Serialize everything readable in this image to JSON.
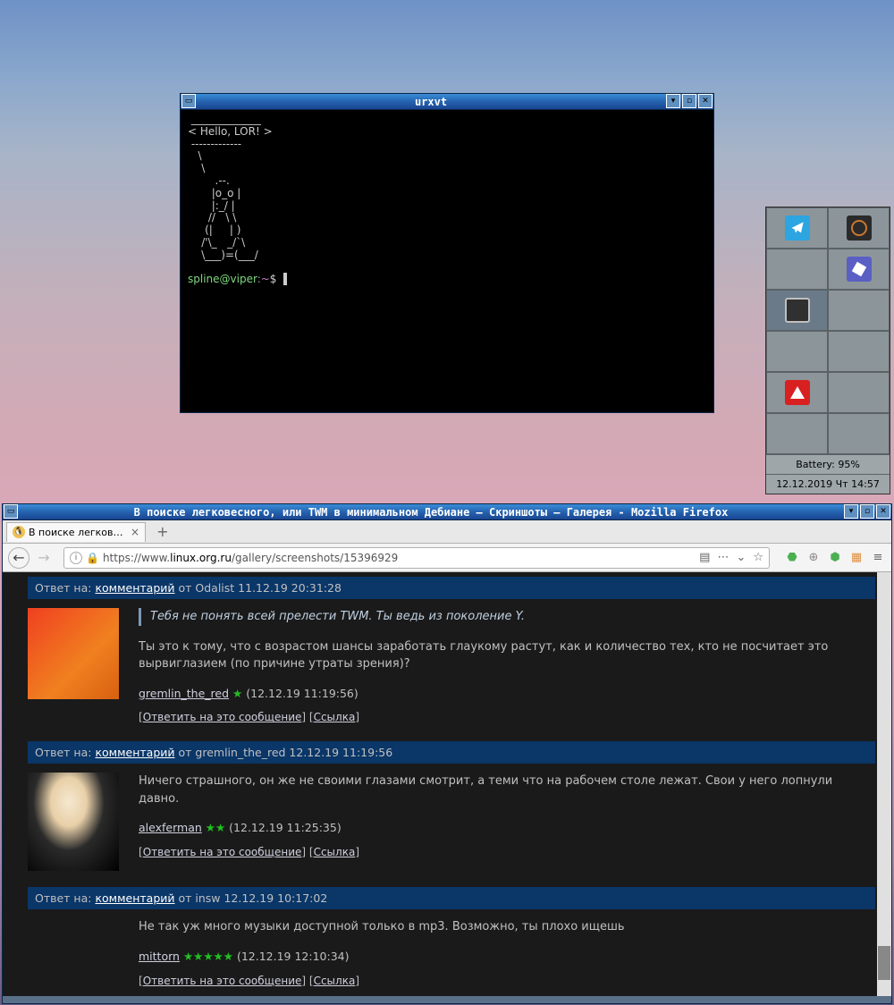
{
  "urxvt": {
    "title": "urxvt",
    "art": " _____________\n< Hello, LOR! >\n -------------\n   \\\n    \\\n        .--.\n       |o_o |\n       |:_/ |\n      //   \\ \\\n     (|     | )\n    /'\\_   _/`\\\n    \\___)=(___/\n",
    "prompt_user": "spline@viper",
    "prompt_sep": ":",
    "prompt_tilde": "~",
    "prompt_dollar": "$"
  },
  "panel": {
    "battery": "Battery: 95%",
    "clock": "12.12.2019 Чт 14:57"
  },
  "firefox": {
    "title": "В поиске легковесного, или TWM в минимальном Дебиане — Скриншоты — Галерея - Mozilla Firefox",
    "tab_text": "В поиске легковесного",
    "url_prefix": "https://www.",
    "url_host": "linux.org.ru",
    "url_path": "/gallery/screenshots/15396929"
  },
  "comments": [
    {
      "reply_to_label": "Ответ на:",
      "reply_link": "комментарий",
      "reply_from": "от Odalist 11.12.19 20:31:28",
      "quote": "Тебя не понять всей прелести TWM. Ты ведь из поколение Y.",
      "text": "Ты это к тому, что с возрастом шансы заработать глаукому растут, как и количество тех, кто не посчитает это вырвиглазием (по причине утраты зрения)?",
      "author": "gremlin_the_red",
      "stars": "★",
      "date": "(12.12.19 11:19:56)",
      "reply_action": "Ответить на это сообщение",
      "link_action": "Ссылка",
      "avatar": "av1"
    },
    {
      "reply_to_label": "Ответ на:",
      "reply_link": "комментарий",
      "reply_from": "от gremlin_the_red 12.12.19 11:19:56",
      "quote": "",
      "text": "Ничего страшного, он же не своими глазами смотрит, а теми что на рабочем столе лежат. Свои у него лопнули давно.",
      "author": "alexferman",
      "stars": "★★",
      "date": "(12.12.19 11:25:35)",
      "reply_action": "Ответить на это сообщение",
      "link_action": "Ссылка",
      "avatar": "av2"
    },
    {
      "reply_to_label": "Ответ на:",
      "reply_link": "комментарий",
      "reply_from": "от insw 12.12.19 10:17:02",
      "quote": "",
      "text": "Не так уж много музыки доступной только в mp3. Возможно, ты плохо ищешь",
      "author": "mittorn",
      "stars": "★★★★★",
      "date": "(12.12.19 12:10:34)",
      "reply_action": "Ответить на это сообщение",
      "link_action": "Ссылка",
      "avatar": "none"
    }
  ]
}
